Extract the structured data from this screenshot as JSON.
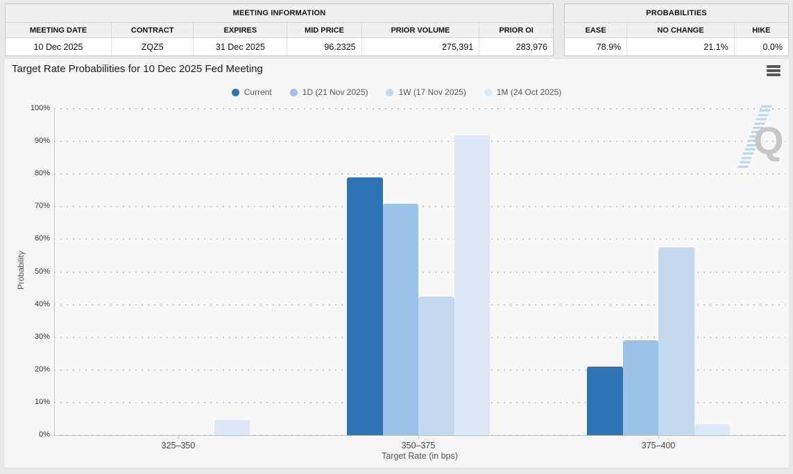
{
  "meeting_info": {
    "title": "MEETING INFORMATION",
    "columns": [
      "MEETING DATE",
      "CONTRACT",
      "EXPIRES",
      "MID PRICE",
      "PRIOR VOLUME",
      "PRIOR OI"
    ],
    "row": [
      "10 Dec 2025",
      "ZQZ5",
      "31 Dec 2025",
      "96.2325",
      "275,391",
      "283,976"
    ]
  },
  "probabilities": {
    "title": "PROBABILITIES",
    "columns": [
      "EASE",
      "NO CHANGE",
      "HIKE"
    ],
    "row": [
      "78.9%",
      "21.1%",
      "0.0%"
    ]
  },
  "chart": {
    "title": "Target Rate Probabilities for 10 Dec 2025 Fed Meeting",
    "menu_icon": "hamburger-icon",
    "watermark_letter": "Q"
  },
  "chart_data": {
    "type": "bar",
    "title": "Target Rate Probabilities for 10 Dec 2025 Fed Meeting",
    "categories": [
      "325–350",
      "350–375",
      "375–400"
    ],
    "series": [
      {
        "name": "Current",
        "color": "#2e74b5",
        "values": [
          0,
          78.9,
          21.1
        ]
      },
      {
        "name": "1D (21 Nov 2025)",
        "color": "#9cc2e5",
        "values": [
          0,
          71.0,
          29.0
        ]
      },
      {
        "name": "1W (17 Nov 2025)",
        "color": "#c3d9ee",
        "values": [
          0,
          42.5,
          57.5
        ]
      },
      {
        "name": "1M (24 Oct 2025)",
        "color": "#dce8f5",
        "values": [
          4.7,
          92.0,
          3.5
        ]
      }
    ],
    "xlabel": "Target Rate (in bps)",
    "ylabel": "Probability",
    "ylim": [
      0,
      100
    ],
    "ytick_step": 10,
    "ytick_labels": [
      "0%",
      "10%",
      "20%",
      "30%",
      "40%",
      "50%",
      "60%",
      "70%",
      "80%",
      "90%",
      "100%"
    ],
    "grid": "dotted-horizontal",
    "legend_position": "top-center"
  }
}
